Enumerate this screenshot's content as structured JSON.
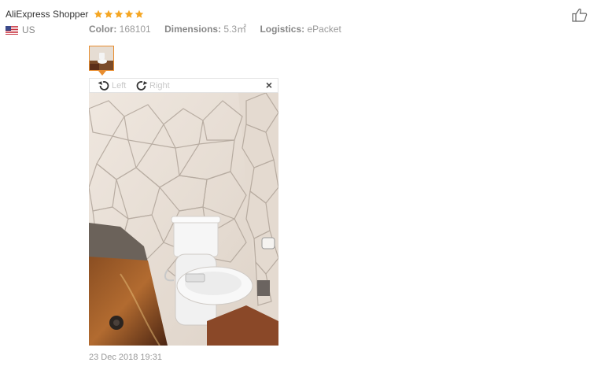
{
  "reviewer": {
    "name": "AliExpress Shopper",
    "rating": 5,
    "country": "US"
  },
  "meta": {
    "color_label": "Color:",
    "color_value": "168101",
    "dimensions_label": "Dimensions:",
    "dimensions_value": "5.3㎡",
    "logistics_label": "Logistics:",
    "logistics_value": "ePacket"
  },
  "viewer": {
    "rotate_left": "Left",
    "rotate_right": "Right",
    "close": "×"
  },
  "date": "23 Dec 2018 19:31",
  "colors": {
    "star": "#f5a623",
    "accent": "#e88d2f",
    "muted": "#999999"
  },
  "icons": {
    "stars": "star-icon",
    "flag": "us-flag-icon",
    "rotate_left": "rotate-left-icon",
    "rotate_right": "rotate-right-icon",
    "close": "close-icon",
    "like": "thumbs-up-icon"
  }
}
